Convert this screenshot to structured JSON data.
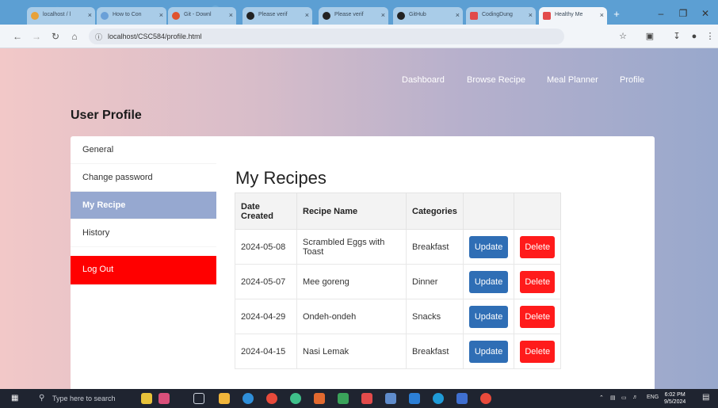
{
  "browser": {
    "tabs": [
      {
        "label": "localhost / l",
        "color": "#e8a23a"
      },
      {
        "label": "How to Con",
        "color": "#6aa0d8"
      },
      {
        "label": "Git - Downl",
        "color": "#e0532f"
      },
      {
        "label": "Please verif",
        "color": "#222222"
      },
      {
        "label": "Please verif",
        "color": "#222222"
      },
      {
        "label": "GitHub",
        "color": "#222222"
      },
      {
        "label": "CodingDung",
        "color": "#e24b4b"
      },
      {
        "label": "Healthy Me",
        "color": "#e24b4b"
      }
    ],
    "tab_close": "×",
    "new_tab": "+",
    "url": "localhost/CSC584/profile.html"
  },
  "nav": {
    "dashboard": "Dashboard",
    "browse": "Browse Recipe",
    "planner": "Meal Planner",
    "profile": "Profile"
  },
  "page_title": "User Profile",
  "menu": {
    "general": "General",
    "change_password": "Change password",
    "my_recipe": "My Recipe",
    "history": "History",
    "logout": "Log Out"
  },
  "recipes": {
    "title": "My Recipes",
    "headers": {
      "date": "Date Created",
      "name": "Recipe Name",
      "category": "Categories"
    },
    "update_label": "Update",
    "delete_label": "Delete",
    "rows": [
      {
        "date": "2024-05-08",
        "name": "Scrambled Eggs with Toast",
        "category": "Breakfast"
      },
      {
        "date": "2024-05-07",
        "name": "Mee goreng",
        "category": "Dinner"
      },
      {
        "date": "2024-04-29",
        "name": "Ondeh-ondeh",
        "category": "Snacks"
      },
      {
        "date": "2024-04-15",
        "name": "Nasi Lemak",
        "category": "Breakfast"
      }
    ]
  },
  "taskbar": {
    "search_placeholder": "Type here to search",
    "lang": "ENG",
    "time": "6:02 PM",
    "date": "9/5/2024"
  },
  "colors": {
    "accent_menu": "#96a8d0",
    "logout": "#ff0000",
    "update": "#2f6eb5",
    "delete": "#ff1b1b"
  }
}
